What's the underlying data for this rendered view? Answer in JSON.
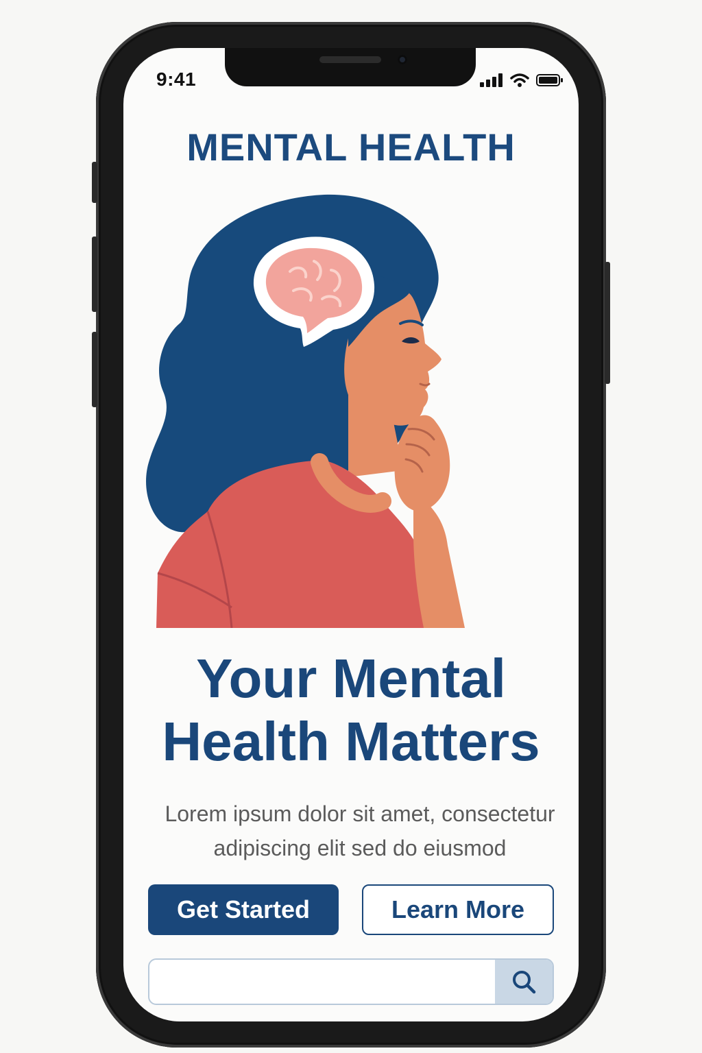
{
  "status_bar": {
    "time": "9:41"
  },
  "header": {
    "title": "MENTAL HEALTH"
  },
  "hero": {
    "illustration_icon": "woman-thinking-brain-illustration",
    "headline_line1": "Your Mental",
    "headline_line2": "Health Matters",
    "subtitle_line1": "Lorem ipsum dolor sit amet, consectetur",
    "subtitle_line2": "adipiscing elit sed do eiusmod"
  },
  "actions": {
    "primary_label": "Get Started",
    "secondary_label": "Learn More"
  },
  "search": {
    "value": "",
    "placeholder": "",
    "icon": "search-icon"
  },
  "colors": {
    "brand_navy": "#1a477a",
    "hair_blue": "#174a7c",
    "skin": "#e58e66",
    "shirt": "#d95c58",
    "brain_pink": "#f2a49c",
    "search_button_bg": "#c9d7e5"
  }
}
